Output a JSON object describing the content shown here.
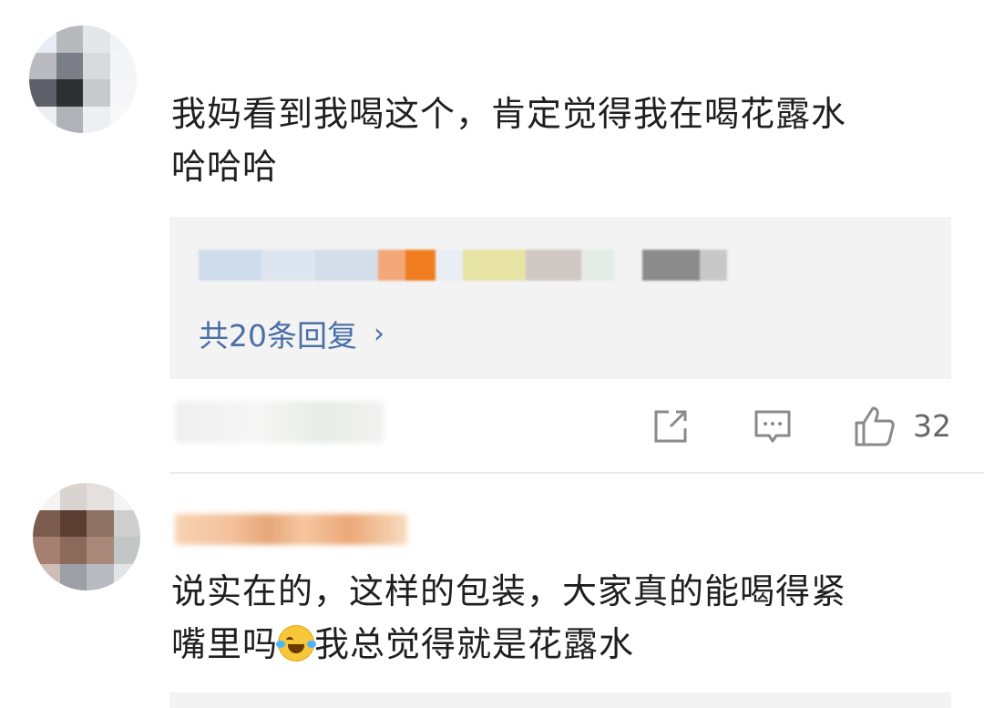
{
  "comments": [
    {
      "text_line1": "我妈看到我喝这个，肯定觉得我在喝花露水",
      "text_line2": "哈哈哈",
      "replies_link": "共20条回复",
      "like_count": "32"
    },
    {
      "text_line1": "说实在的，这样的包装，大家真的能喝得紧",
      "text_line2_prefix": "嘴里吗",
      "emoji": "laughing-crying-emoji",
      "text_line2_suffix": "我总觉得就是花露水"
    }
  ],
  "icons": {
    "share": "share-icon",
    "comment": "comment-icon",
    "like": "thumbs-up-icon",
    "chevron": "›"
  },
  "colors": {
    "link": "#4a6fa5",
    "reply_bg": "#f3f3f3",
    "icon": "#888888"
  }
}
